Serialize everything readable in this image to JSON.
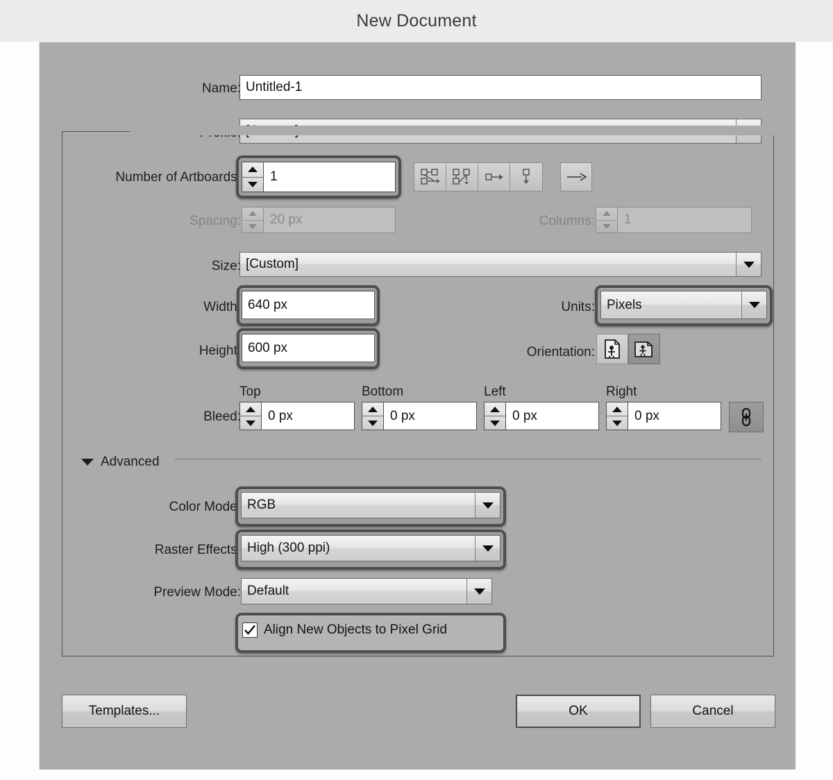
{
  "titlebar": {
    "title": "New Document"
  },
  "fields": {
    "name_label": "Name:",
    "name_value": "Untitled-1",
    "profile_label": "Profile:",
    "profile_value": "[Custom]",
    "artboards_label": "Number of Artboards:",
    "artboards_value": "1",
    "spacing_label": "Spacing:",
    "spacing_value": "20 px",
    "columns_label": "Columns:",
    "columns_value": "1",
    "size_label": "Size:",
    "size_value": "[Custom]",
    "width_label": "Width:",
    "width_value": "640 px",
    "height_label": "Height:",
    "height_value": "600 px",
    "units_label": "Units:",
    "units_value": "Pixels",
    "orientation_label": "Orientation:",
    "bleed_label": "Bleed:",
    "bleed_top_header": "Top",
    "bleed_top_value": "0 px",
    "bleed_bottom_header": "Bottom",
    "bleed_bottom_value": "0 px",
    "bleed_left_header": "Left",
    "bleed_left_value": "0 px",
    "bleed_right_header": "Right",
    "bleed_right_value": "0 px"
  },
  "advanced": {
    "section_label": "Advanced",
    "color_mode_label": "Color Mode:",
    "color_mode_value": "RGB",
    "raster_label": "Raster Effects:",
    "raster_value": "High (300 ppi)",
    "preview_label": "Preview Mode:",
    "preview_value": "Default",
    "align_pixel_grid_label": "Align New Objects to Pixel Grid",
    "align_pixel_grid_checked": "✓"
  },
  "footer": {
    "templates_label": "Templates...",
    "ok_label": "OK",
    "cancel_label": "Cancel"
  },
  "colors": {
    "dialog_bg": "#ababab",
    "titlebar_bg": "#ebebeb",
    "focus_ring": "#4e4e4e",
    "input_bg": "#ffffff",
    "disabled_text": "#8a8a8a"
  }
}
